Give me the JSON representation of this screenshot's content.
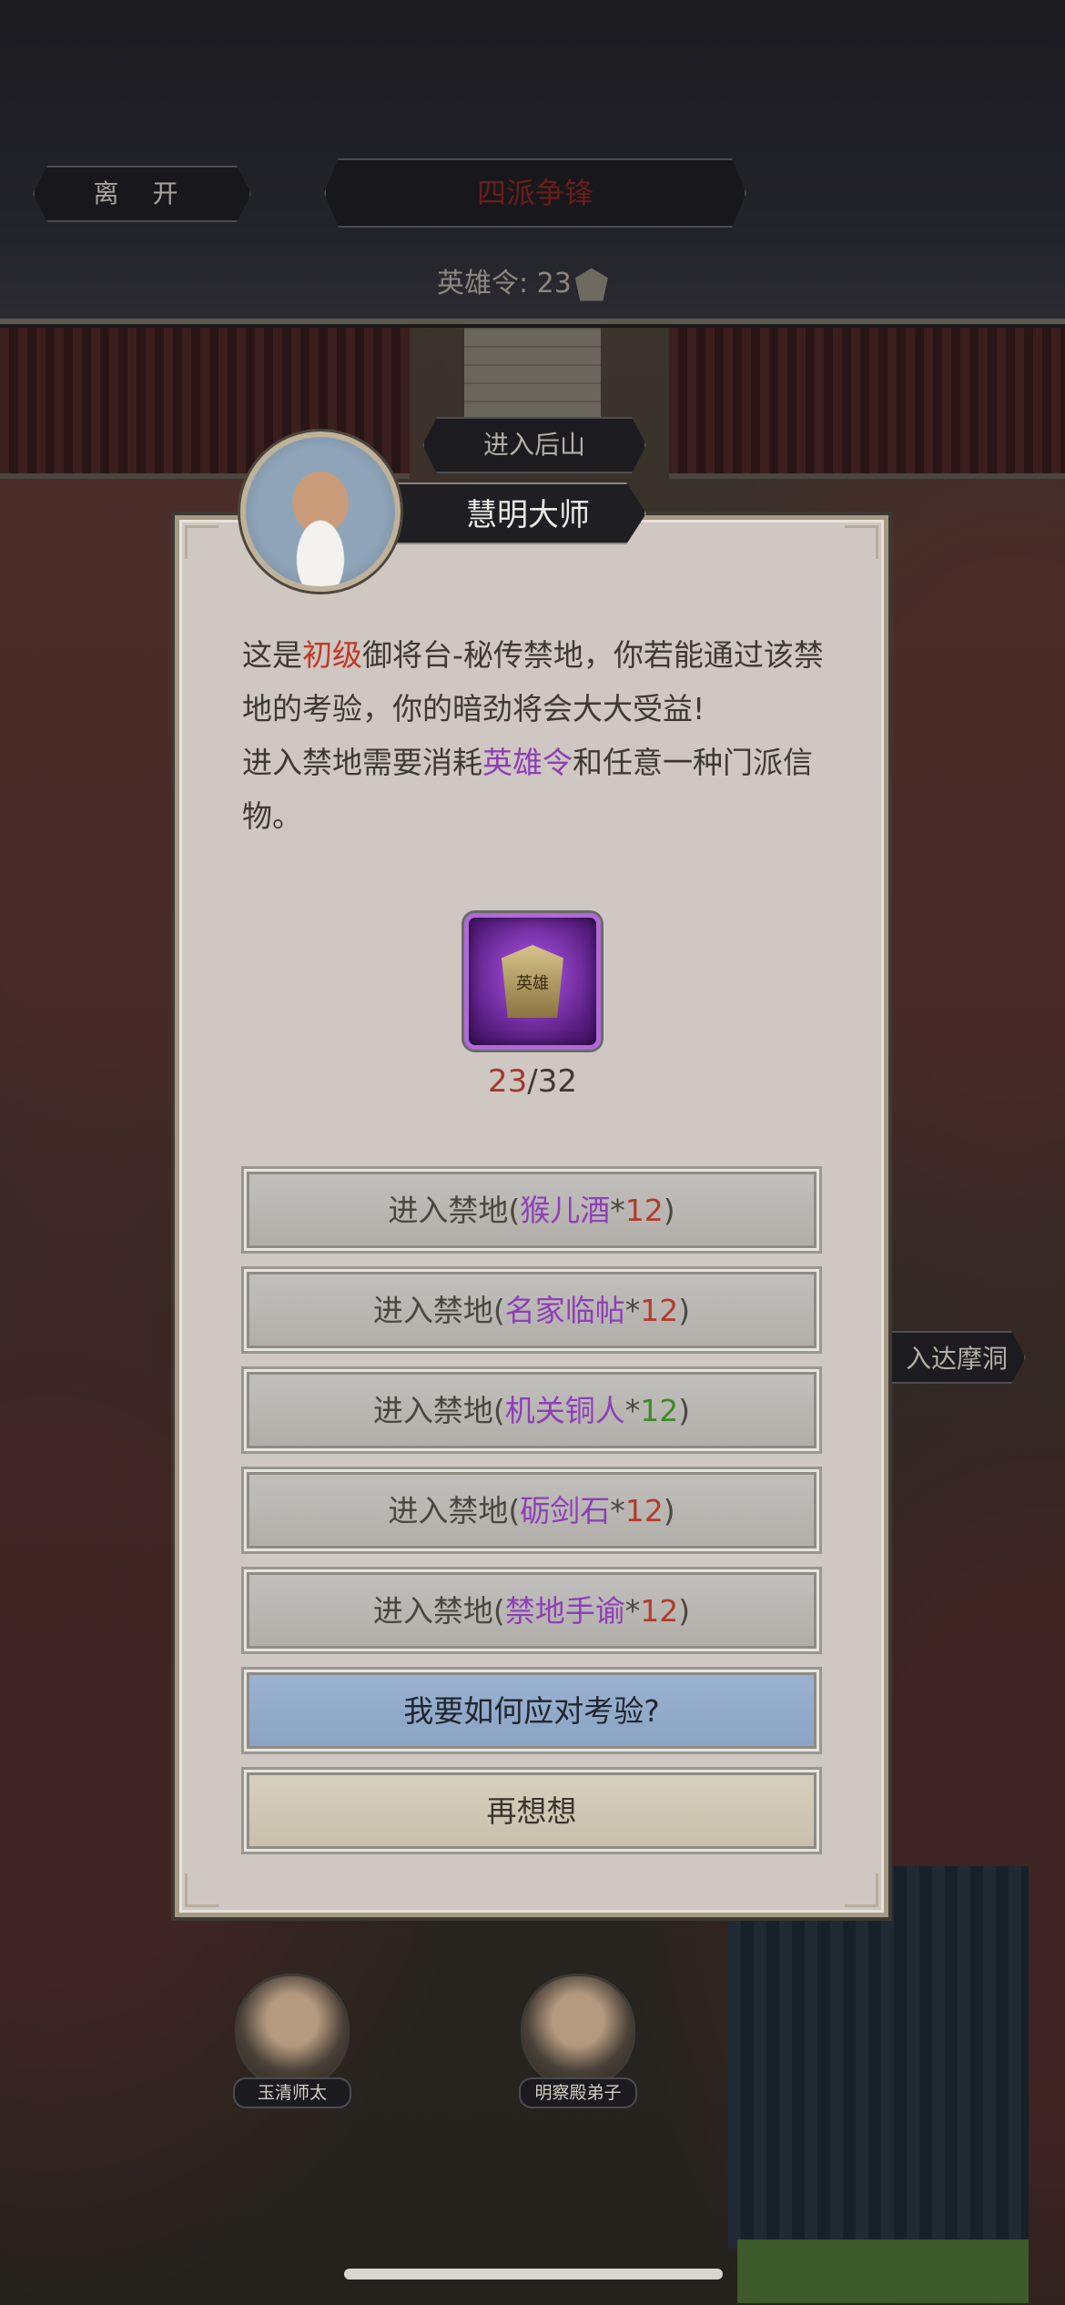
{
  "header": {
    "leave_label": "离 开",
    "title": "四派争锋",
    "hero_token_label": "英雄令: 23"
  },
  "map": {
    "enter_back_mountain": "进入后山",
    "enter_damo_cave": "入达摩洞"
  },
  "npcs": [
    {
      "name": "玉清师太"
    },
    {
      "name": "明察殿弟子"
    }
  ],
  "dialog": {
    "speaker": "慧明大师",
    "text_parts": {
      "p1": "这是",
      "level": "初级",
      "p2": "御将台-秘传禁地，你若能通过该禁地的考验，你的暗劲将会大大受益!",
      "p3": "进入禁地需要消耗",
      "token": "英雄令",
      "p4": "和任意一种门派信物。"
    },
    "item": {
      "icon_text": "英雄",
      "current": "23",
      "total": "/32"
    },
    "options": [
      {
        "prefix": "进入禁地(",
        "item": "猴儿酒",
        "star": "*",
        "count": "12",
        "suffix": ")",
        "count_color": "red"
      },
      {
        "prefix": "进入禁地(",
        "item": "名家临帖",
        "star": "*",
        "count": "12",
        "suffix": ")",
        "count_color": "red"
      },
      {
        "prefix": "进入禁地(",
        "item": "机关铜人",
        "star": "*",
        "count": "12",
        "suffix": ")",
        "count_color": "green"
      },
      {
        "prefix": "进入禁地(",
        "item": "砺剑石",
        "star": "*",
        "count": "12",
        "suffix": ")",
        "count_color": "red"
      },
      {
        "prefix": "进入禁地(",
        "item": "禁地手谕",
        "star": "*",
        "count": "12",
        "suffix": ")",
        "count_color": "red"
      }
    ],
    "how_to_label": "我要如何应对考验?",
    "reconsider_label": "再想想"
  },
  "colors": {
    "highlight_red": "#c0392b",
    "highlight_purple": "#8e3fb8",
    "count_green": "#3f8a2a",
    "dialog_bg": "#cfc7c1"
  }
}
